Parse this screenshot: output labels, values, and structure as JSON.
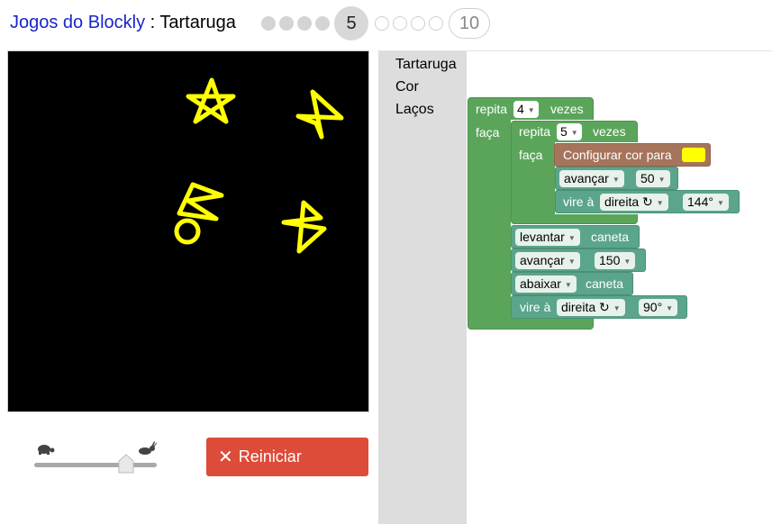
{
  "header": {
    "app_link": "Jogos do Blockly",
    "separator": " : ",
    "game_name": "Tartaruga",
    "levels_done": [
      1,
      2,
      3,
      4
    ],
    "current_level": "5",
    "levels_todo": [
      6,
      7,
      8,
      9
    ],
    "last_level": "10"
  },
  "controls": {
    "slow_icon": "turtle-icon",
    "fast_icon": "rabbit-icon",
    "speed_level": 0.75,
    "reset_label": "Reiniciar",
    "reset_color": "#dd4b39"
  },
  "canvas": {
    "background": "#000000",
    "pen_color": "#ffff00"
  },
  "toolbox": {
    "categories": [
      "Tartaruga",
      "Cor",
      "Laços"
    ]
  },
  "program": {
    "outer_repeat": {
      "keyword": "repita",
      "count": "4",
      "suffix": "vezes",
      "do_label": "faça"
    },
    "inner_repeat": {
      "keyword": "repita",
      "count": "5",
      "suffix": "vezes",
      "do_label": "faça"
    },
    "set_color": {
      "label": "Configurar cor para",
      "color": "#ffff00"
    },
    "move_forward_1": {
      "action": "avançar",
      "value": "50"
    },
    "turn_1": {
      "label": "vire à",
      "direction": "direita ↻",
      "angle": "144°"
    },
    "pen_up": {
      "action": "levantar",
      "suffix": "caneta"
    },
    "move_forward_2": {
      "action": "avançar",
      "value": "150"
    },
    "pen_down": {
      "action": "abaixar",
      "suffix": "caneta"
    },
    "turn_2": {
      "label": "vire à",
      "direction": "direita ↻",
      "angle": "90°"
    }
  }
}
